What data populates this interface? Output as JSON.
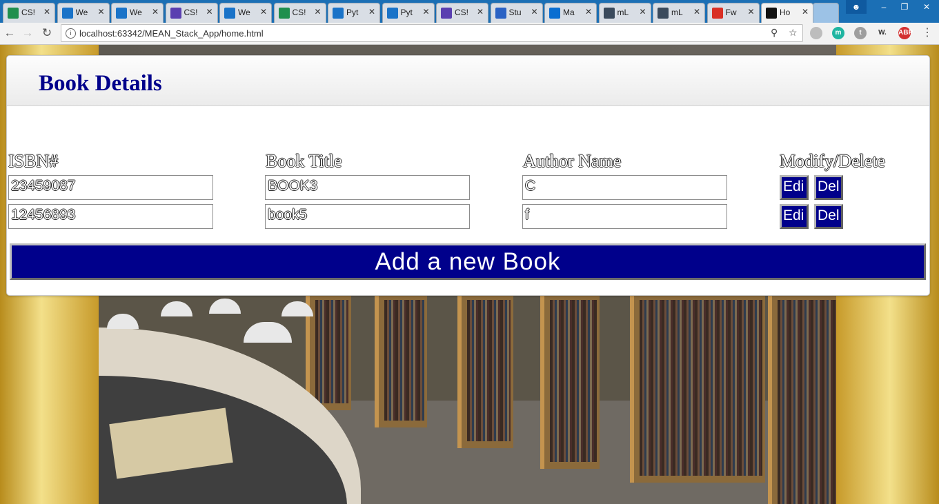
{
  "browser": {
    "tabs": [
      {
        "title": "CS!",
        "icon": "sheets-icon",
        "color": "#1f8f4e"
      },
      {
        "title": "We",
        "icon": "box-icon",
        "color": "#1a73c8"
      },
      {
        "title": "We",
        "icon": "box-icon",
        "color": "#1a73c8"
      },
      {
        "title": "CS!",
        "icon": "forms-icon",
        "color": "#5a3fb0"
      },
      {
        "title": "We",
        "icon": "box-icon",
        "color": "#1a73c8"
      },
      {
        "title": "CS!",
        "icon": "sheets-icon",
        "color": "#1f8f4e"
      },
      {
        "title": "Pyt",
        "icon": "box-icon",
        "color": "#1a73c8"
      },
      {
        "title": "Pyt",
        "icon": "box-icon",
        "color": "#1a73c8"
      },
      {
        "title": "CS!",
        "icon": "forms-icon",
        "color": "#5a3fb0"
      },
      {
        "title": "Stu",
        "icon": "studio-icon",
        "color": "#2a62c4"
      },
      {
        "title": "Ma",
        "icon": "outlook-icon",
        "color": "#0a6ed1"
      },
      {
        "title": "mL",
        "icon": "mlab-icon",
        "color": "#3a4a5c"
      },
      {
        "title": "mL",
        "icon": "mlab-icon",
        "color": "#3a4a5c"
      },
      {
        "title": "Fw",
        "icon": "gmail-icon",
        "color": "#d93025"
      },
      {
        "title": "Ho",
        "icon": "webstorm-icon",
        "color": "#111111"
      }
    ],
    "url": "localhost:63342/MEAN_Stack_App/home.html",
    "extensions": [
      {
        "name": "chrome-ext-icon",
        "label": "",
        "color": "#bdbdbd"
      },
      {
        "name": "m-ext-icon",
        "label": "m",
        "color": "#1fb5a1"
      },
      {
        "name": "translate-ext-icon",
        "label": "t",
        "color": "#9e9e9e"
      },
      {
        "name": "w-ext-icon",
        "label": "W.",
        "color": "#f2f2f2"
      },
      {
        "name": "adblock-plus-icon",
        "label": "ABP",
        "color": "#d32f2f"
      }
    ]
  },
  "page": {
    "heading": "Book Details",
    "columns": {
      "isbn": "ISBN#",
      "title": "Book Title",
      "author": "Author Name",
      "actions": "Modify/Delete"
    },
    "rows": [
      {
        "isbn": "23459087",
        "title": "BOOK3",
        "author": "C",
        "edit": "Edi",
        "delete": "Del"
      },
      {
        "isbn": "12456893",
        "title": "book5",
        "author": "f",
        "edit": "Edi",
        "delete": "Del"
      }
    ],
    "add_button": "Add a new Book"
  }
}
